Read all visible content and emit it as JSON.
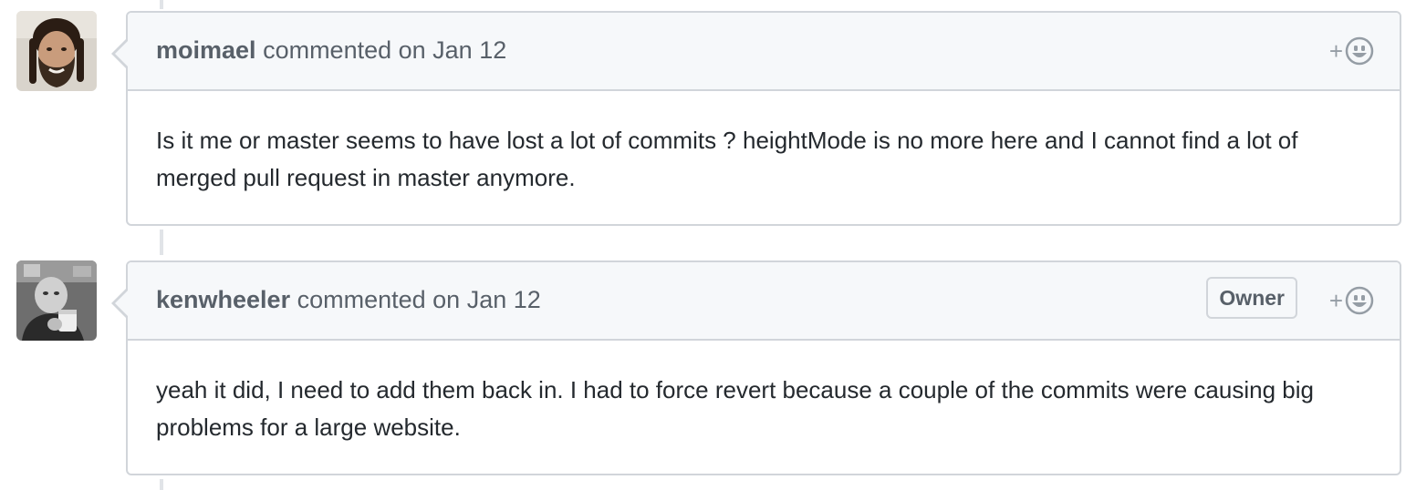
{
  "comments": [
    {
      "author": "moimael",
      "action_text": "commented on Jan 12",
      "badge": null,
      "body": "Is it me or master seems to have lost a lot of commits ? heightMode is no more here and I cannot find a lot of merged pull request in master anymore.",
      "avatar_icon": "bearded-man-avatar"
    },
    {
      "author": "kenwheeler",
      "action_text": "commented on Jan 12",
      "badge": "Owner",
      "body": "yeah it did, I need to add them back in. I had to force revert because a couple of the commits were causing big problems for a large website.",
      "avatar_icon": "man-with-cup-avatar"
    }
  ],
  "reaction_icon": "smiley-add-reaction-icon",
  "colors": {
    "border": "#d1d5da",
    "header_bg": "#f6f8fa",
    "muted_text": "#586069",
    "body_text": "#24292e",
    "timeline": "#e1e4e8"
  }
}
